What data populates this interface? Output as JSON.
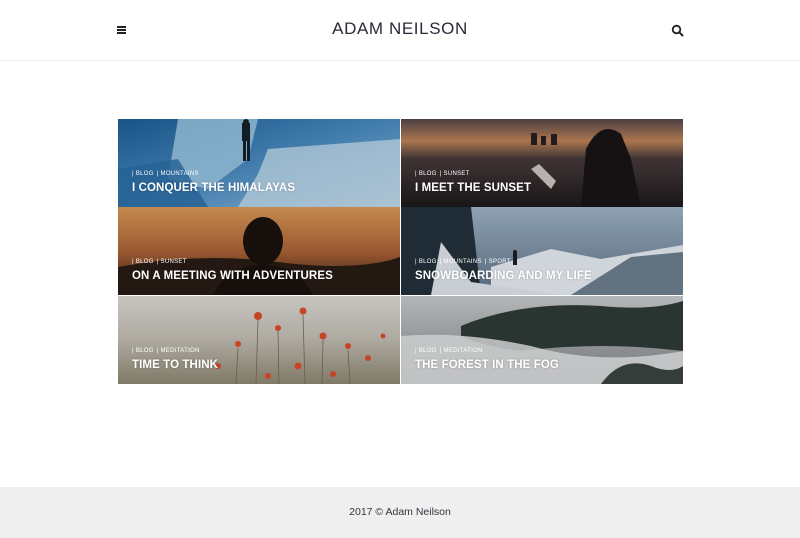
{
  "header": {
    "site_title": "ADAM NEILSON",
    "menu_icon": "hamburger-menu-icon",
    "search_icon": "search-icon"
  },
  "posts": [
    {
      "categories": [
        "| BLOG",
        "| MOUNTAINS"
      ],
      "title": "I CONQUER THE HIMALAYAS"
    },
    {
      "categories": [
        "| BLOG",
        "| SUNSET"
      ],
      "title": "I MEET THE SUNSET"
    },
    {
      "categories": [
        "| BLOG",
        "| SUNSET"
      ],
      "title": "ON A MEETING WITH ADVENTURES"
    },
    {
      "categories": [
        "| BLOG",
        "| MOUNTAINS",
        "| SPORT"
      ],
      "title": "SNOWBOARDING AND MY LIFE"
    },
    {
      "categories": [
        "| BLOG",
        "| MEDITATION"
      ],
      "title": "TIME TO THINK"
    },
    {
      "categories": [
        "| BLOG",
        "| MEDITATION"
      ],
      "title": "THE FOREST IN THE FOG"
    }
  ],
  "footer": {
    "copyright": "2017 © Adam Neilson"
  },
  "colors": {
    "header_bg": "#ffffff",
    "footer_bg": "#efefef",
    "title_text": "#2a2a3a"
  }
}
